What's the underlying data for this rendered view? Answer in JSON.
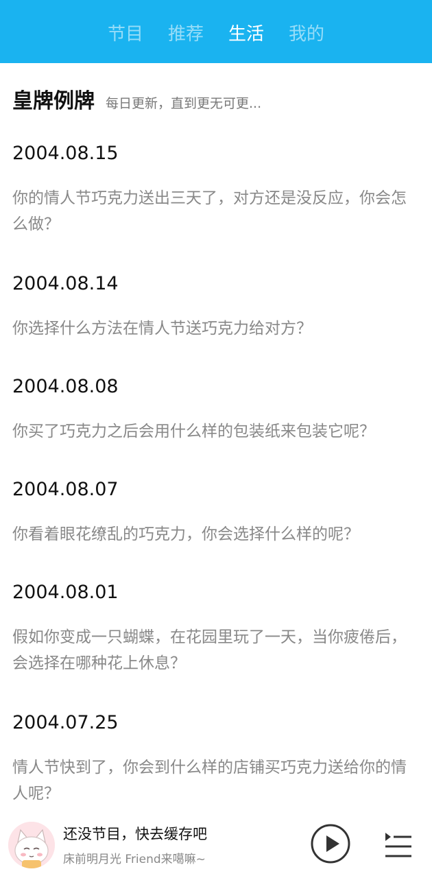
{
  "nav": {
    "tabs": [
      "节目",
      "推荐",
      "生活",
      "我的"
    ],
    "active_tab": "生活"
  },
  "section": {
    "title": "皇牌例牌",
    "subtitle": "每日更新，直到更无可更..."
  },
  "entries": [
    {
      "date": "2004.08.15",
      "question": "你的情人节巧克力送出三天了，对方还是没反应，你会怎么做？"
    },
    {
      "date": "2004.08.14",
      "question": "你选择什么方法在情人节送巧克力给对方？"
    },
    {
      "date": "2004.08.08",
      "question": "你买了巧克力之后会用什么样的包装纸来包装它呢？"
    },
    {
      "date": "2004.08.07",
      "question": "你看着眼花缭乱的巧克力，你会选择什么样的呢？"
    },
    {
      "date": "2004.08.01",
      "question": "假如你变成一只蝴蝶，在花园里玩了一天，当你疲倦后，会选择在哪种花上休息？"
    },
    {
      "date": "2004.07.25",
      "question": "情人节快到了，你会到什么样的店铺买巧克力送给你的情人呢？"
    }
  ],
  "player": {
    "title": "还没节目，快去缓存吧",
    "subtitle": "床前明月光 Friend来噶嘛~",
    "icons": [
      "cat-avatar",
      "play-icon",
      "playlist-icon"
    ]
  },
  "colors": {
    "accent": "#1ab3f0",
    "tab_active": "#ffffff",
    "tab_inactive": "#9fdcf7",
    "question_text": "#888888"
  }
}
